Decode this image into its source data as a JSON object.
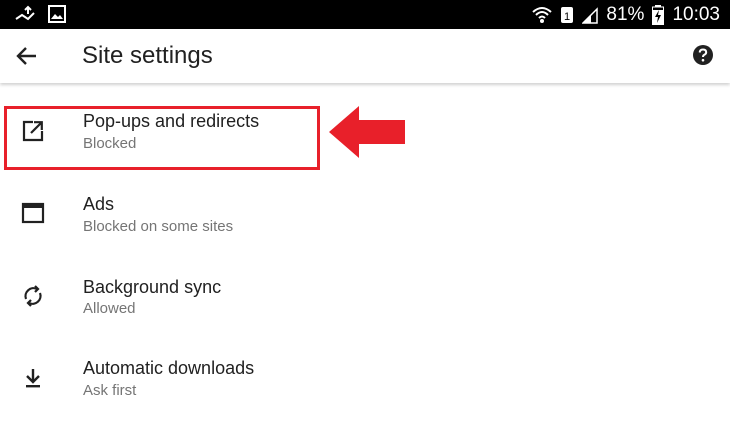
{
  "status_bar": {
    "battery_percent": "81%",
    "time": "10:03"
  },
  "app_bar": {
    "title": "Site settings",
    "back_icon": "arrow-left-icon",
    "help_icon": "help-circle-icon"
  },
  "items": [
    {
      "icon": "open-in-new-icon",
      "title": "Pop-ups and redirects",
      "subtitle": "Blocked"
    },
    {
      "icon": "window-icon",
      "title": "Ads",
      "subtitle": "Blocked on some sites"
    },
    {
      "icon": "sync-icon",
      "title": "Background sync",
      "subtitle": "Allowed"
    },
    {
      "icon": "download-icon",
      "title": "Automatic downloads",
      "subtitle": "Ask first"
    }
  ],
  "colors": {
    "highlight": "#e8202a",
    "primary_text": "#212121",
    "secondary_text": "#757575",
    "status_bar": "#000000"
  }
}
